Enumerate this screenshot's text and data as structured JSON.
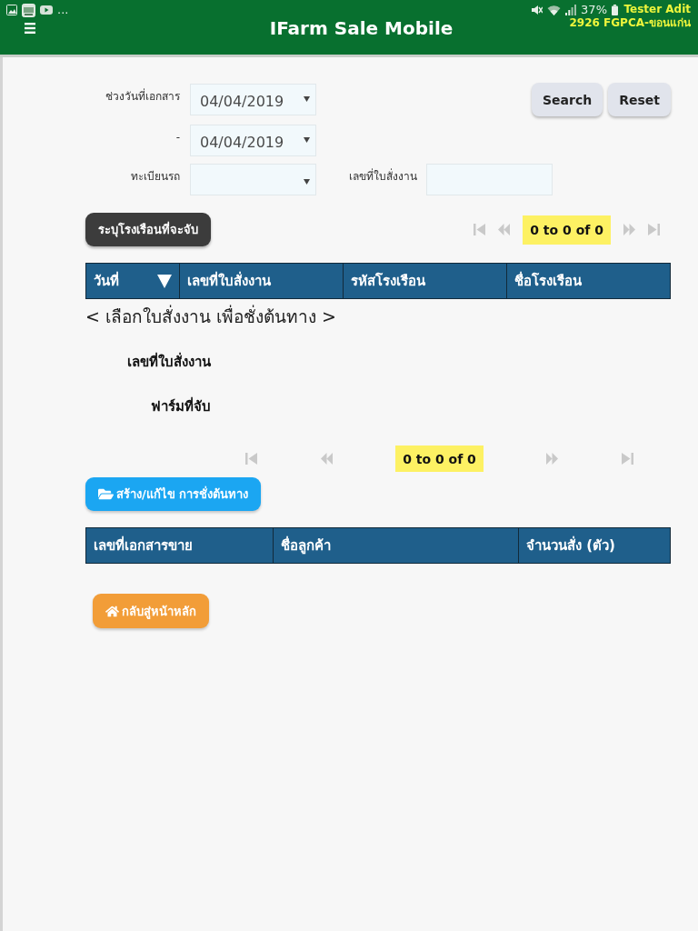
{
  "status_bar": {
    "more_text": "...",
    "battery_text": "37%"
  },
  "header": {
    "title": "IFarm Sale Mobile",
    "user": "Tester Adit",
    "branch": "2926 FGPCA-ขอนแก่น"
  },
  "filter_rows": [
    {
      "fields": [
        {
          "label": "ช่วงวันที่เอกสาร",
          "kind": "select",
          "value": "04/04/2019"
        }
      ]
    },
    {
      "fields": [
        {
          "label": "-",
          "kind": "select",
          "value": "04/04/2019"
        }
      ]
    },
    {
      "fields": [
        {
          "label": "ทะเบียนรถ",
          "kind": "select"
        },
        {
          "label": "เลขที่ใบสั่งงาน",
          "kind": "input"
        }
      ]
    }
  ],
  "search_buttons": [
    "Search",
    "Reset"
  ],
  "house_button": "ระบุโรงเรือนที่จะจับ",
  "pager_top": {
    "summary": "0 to 0 of 0",
    "controls": [
      {
        "kind": "first",
        "disabled": true
      },
      {
        "kind": "previous",
        "disabled": true
      },
      {
        "kind": "next",
        "disabled": true
      },
      {
        "kind": "last",
        "disabled": true
      }
    ]
  },
  "orders_table": {
    "columns": [
      {
        "label": "วันที่",
        "sorted": true
      },
      {
        "label": "เลขที่ใบสั่งงาน",
        "sorted": false
      },
      {
        "label": "รหัสโรงเรือน",
        "sorted": false
      },
      {
        "label": "ชื่อโรงเรือน",
        "sorted": false
      }
    ]
  },
  "prompt": "< เลือกใบสั่งงาน เพื่อชั่งต้นทาง >",
  "detail_labels": [
    "เลขที่ใบสั่งงาน",
    "ฟาร์มที่จับ"
  ],
  "pager_bottom": {
    "summary": "0 to 0 of 0",
    "controls": [
      {
        "kind": "first",
        "disabled": true
      },
      {
        "kind": "previous",
        "disabled": true
      },
      {
        "kind": "next",
        "disabled": true
      },
      {
        "kind": "last",
        "disabled": true
      }
    ]
  },
  "weigh_button": "สร้าง/แก้ไข การชั่งต้นทาง",
  "sales_table": {
    "columns": [
      {
        "label": "เลขที่เอกสารขาย"
      },
      {
        "label": "ชื่อลูกค้า"
      },
      {
        "label": "จำนวนสั่ง (ตัว)"
      }
    ]
  },
  "home_button": "กลับสู่หน้าหลัก"
}
